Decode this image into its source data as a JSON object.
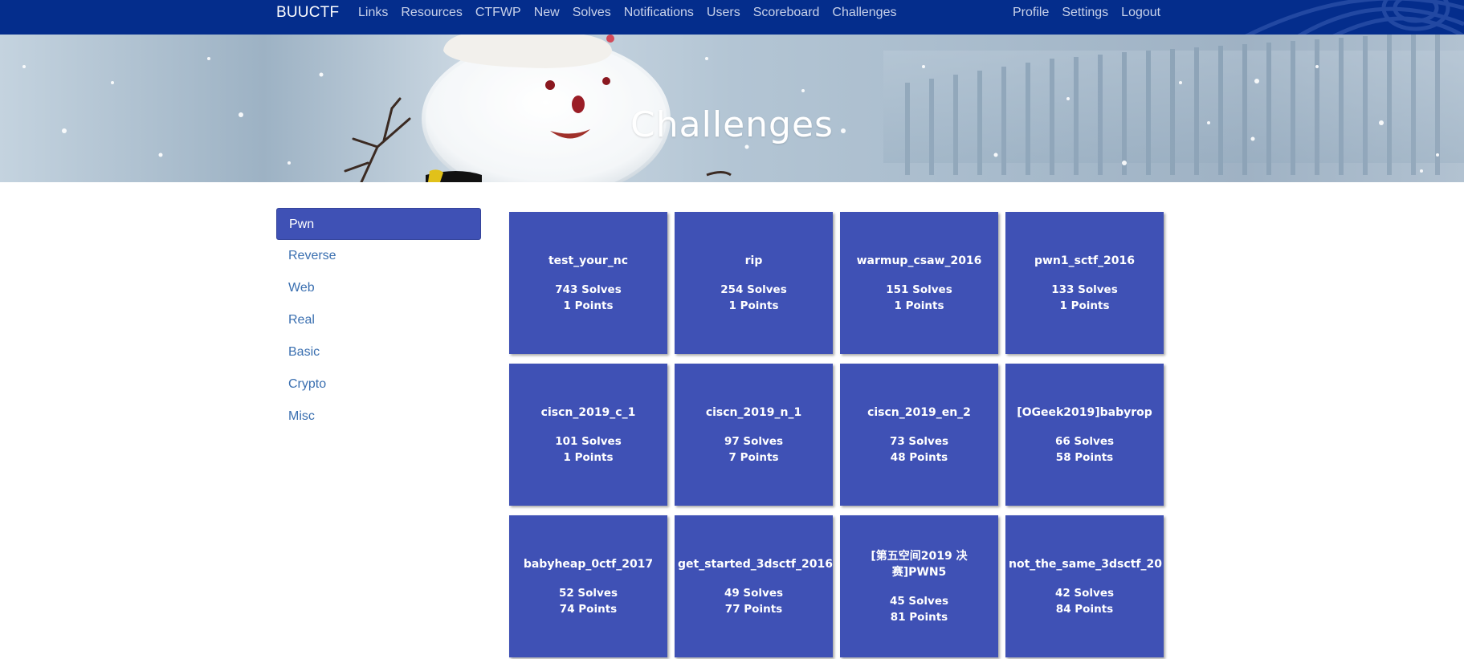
{
  "navbar": {
    "brand": "BUUCTF",
    "left_links": [
      "Links",
      "Resources",
      "CTFWP",
      "New",
      "Solves",
      "Notifications",
      "Users",
      "Scoreboard",
      "Challenges"
    ],
    "right_links": [
      "Profile",
      "Settings",
      "Logout"
    ],
    "background_color": "#042d8c"
  },
  "hero": {
    "title": "Challenges"
  },
  "sidebar": {
    "active": "Pwn",
    "categories": [
      "Pwn",
      "Reverse",
      "Web",
      "Real",
      "Basic",
      "Crypto",
      "Misc"
    ]
  },
  "challenges": [
    {
      "name": "test_your_nc",
      "solves": "743 Solves",
      "points": "1 Points"
    },
    {
      "name": "rip",
      "solves": "254 Solves",
      "points": "1 Points"
    },
    {
      "name": "warmup_csaw_2016",
      "solves": "151 Solves",
      "points": "1 Points"
    },
    {
      "name": "pwn1_sctf_2016",
      "solves": "133 Solves",
      "points": "1 Points"
    },
    {
      "name": "ciscn_2019_c_1",
      "solves": "101 Solves",
      "points": "1 Points"
    },
    {
      "name": "ciscn_2019_n_1",
      "solves": "97 Solves",
      "points": "7 Points"
    },
    {
      "name": "ciscn_2019_en_2",
      "solves": "73 Solves",
      "points": "48 Points"
    },
    {
      "name": "[OGeek2019]babyrop",
      "solves": "66 Solves",
      "points": "58 Points"
    },
    {
      "name": "babyheap_0ctf_2017",
      "solves": "52 Solves",
      "points": "74 Points"
    },
    {
      "name": "get_started_3dsctf_2016",
      "solves": "49 Solves",
      "points": "77 Points"
    },
    {
      "name": "[第五空间2019 决赛]PWN5",
      "solves": "45 Solves",
      "points": "81 Points"
    },
    {
      "name": "not_the_same_3dsctf_20",
      "solves": "42 Solves",
      "points": "84 Points"
    }
  ],
  "colors": {
    "card": "#3f51b5",
    "active_category": "#3f51b5",
    "link": "#3a6fb0"
  }
}
